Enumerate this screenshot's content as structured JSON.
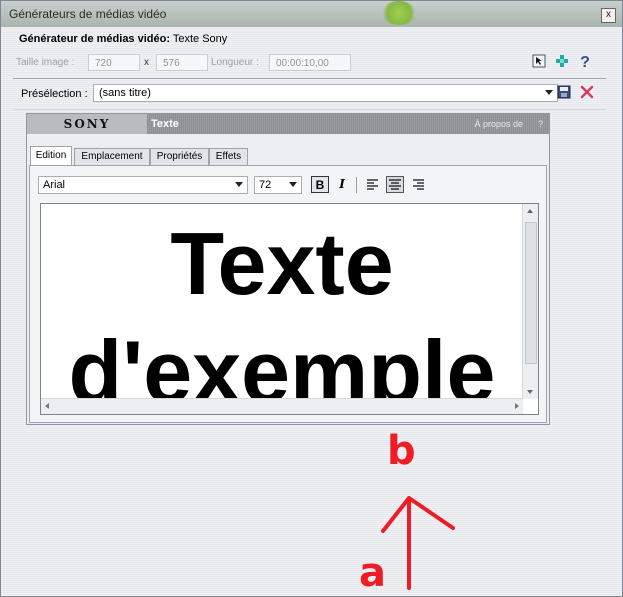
{
  "window": {
    "title": "Générateurs de médias vidéo",
    "close_glyph": "x"
  },
  "generator": {
    "label": "Générateur de médias vidéo:",
    "name": "Texte Sony"
  },
  "frame_size": {
    "label": "Taille image :",
    "width": "720",
    "separator": "x",
    "height": "576",
    "length_label": "Longueur :",
    "length": "00:00:10,00"
  },
  "toolbar_icons": [
    "select-icon",
    "add-plugin-icon",
    "help-icon"
  ],
  "preset": {
    "label": "Présélection :",
    "value": "(sans titre)"
  },
  "plugin": {
    "logo": "SONY",
    "name": "Texte",
    "about": "À propos de",
    "about_help": "?"
  },
  "tabs": [
    {
      "label": "Edition",
      "active": true
    },
    {
      "label": "Emplacement",
      "active": false
    },
    {
      "label": "Propriétés",
      "active": false
    },
    {
      "label": "Effets",
      "active": false
    }
  ],
  "format": {
    "font": "Arial",
    "size": "72",
    "bold_label": "B",
    "italic_label": "I"
  },
  "editor": {
    "text": "Texte\nd'exemple"
  },
  "annotation": {
    "start_label": "a",
    "end_label": "b",
    "color": "#ee1c24"
  }
}
